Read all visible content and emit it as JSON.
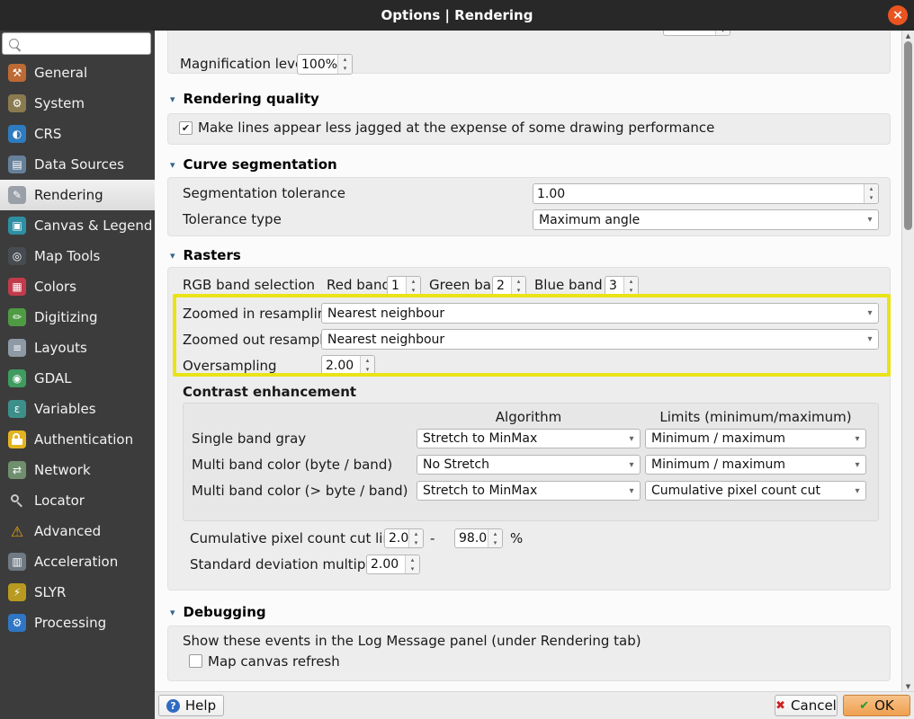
{
  "window": {
    "title": "Options | Rendering"
  },
  "icons": {
    "close": "×",
    "check": "✔",
    "combo_arrow": "▾",
    "spin_up": "▴",
    "spin_down": "▾",
    "section_arrow": "▾",
    "scroll_up": "▲",
    "scroll_down": "▼",
    "help": "?",
    "cancel_x": "✖",
    "ok_check": "✔"
  },
  "colors": {
    "highlight_yellow": "#e9e318",
    "titlebar": "#282828",
    "close_button": "#e95420",
    "ok_button_accent": "#efa050",
    "sidebar_bg": "#3c3c3c"
  },
  "sidebar": {
    "search": {
      "value": ""
    },
    "items": [
      {
        "label": "General",
        "icon": "wrench-icon",
        "glyph": "⚒"
      },
      {
        "label": "System",
        "icon": "gear-icon",
        "glyph": "⚙"
      },
      {
        "label": "CRS",
        "icon": "globe-icon",
        "glyph": "◐"
      },
      {
        "label": "Data Sources",
        "icon": "database-icon",
        "glyph": "▤"
      },
      {
        "label": "Rendering",
        "icon": "paintbrush-icon",
        "glyph": "✎"
      },
      {
        "label": "Canvas & Legend",
        "icon": "canvas-legend-icon",
        "glyph": "▣"
      },
      {
        "label": "Map Tools",
        "icon": "map-tools-icon",
        "glyph": "◎"
      },
      {
        "label": "Colors",
        "icon": "palette-icon",
        "glyph": "▦"
      },
      {
        "label": "Digitizing",
        "icon": "pencil-icon",
        "glyph": "✏"
      },
      {
        "label": "Layouts",
        "icon": "layouts-icon",
        "glyph": "≡"
      },
      {
        "label": "GDAL",
        "icon": "raster-globe-icon",
        "glyph": "◉"
      },
      {
        "label": "Variables",
        "icon": "epsilon-icon",
        "glyph": "ε"
      },
      {
        "label": "Authentication",
        "icon": "lock-icon",
        "glyph": ""
      },
      {
        "label": "Network",
        "icon": "network-icon",
        "glyph": "⇄"
      },
      {
        "label": "Locator",
        "icon": "magnifier-icon",
        "glyph": ""
      },
      {
        "label": "Advanced",
        "icon": "warning-icon",
        "glyph": "⚠"
      },
      {
        "label": "Acceleration",
        "icon": "chip-icon",
        "glyph": "▥"
      },
      {
        "label": "SLYR",
        "icon": "lightning-icon",
        "glyph": "⚡"
      },
      {
        "label": "Processing",
        "icon": "processing-gear-icon",
        "glyph": "⚙"
      }
    ]
  },
  "content": {
    "magnification": {
      "label": "Magnification level",
      "value": "100%"
    },
    "rendering_quality": {
      "header": "Rendering quality",
      "checkbox_label": "Make lines appear less jagged at the expense of some drawing performance",
      "checked": true
    },
    "curve_segmentation": {
      "header": "Curve segmentation",
      "tolerance_label": "Segmentation tolerance",
      "tolerance_value": "1.00",
      "type_label": "Tolerance type",
      "type_value": "Maximum angle"
    },
    "rasters": {
      "header": "Rasters",
      "rgb_label": "RGB band selection",
      "red_band": {
        "label": "Red band",
        "value": "1"
      },
      "green_band": {
        "label": "Green band",
        "value": "2"
      },
      "blue_band": {
        "label": "Blue band",
        "value": "3"
      },
      "zoomed_in": {
        "label": "Zoomed in resampling",
        "value": "Nearest neighbour"
      },
      "zoomed_out": {
        "label": "Zoomed out resampling",
        "value": "Nearest neighbour"
      },
      "oversampling": {
        "label": "Oversampling",
        "value": "2.00"
      },
      "contrast": {
        "title": "Contrast enhancement",
        "col_algorithm": "Algorithm",
        "col_limits": "Limits (minimum/maximum)",
        "rows": [
          {
            "label": "Single band gray",
            "algorithm": "Stretch to MinMax",
            "limits": "Minimum / maximum"
          },
          {
            "label": "Multi band color (byte / band)",
            "algorithm": "No Stretch",
            "limits": "Minimum / maximum"
          },
          {
            "label": "Multi band color (> byte / band)",
            "algorithm": "Stretch to MinMax",
            "limits": "Cumulative pixel count cut"
          }
        ],
        "cumulative": {
          "label": "Cumulative pixel count cut limits",
          "min": "2.0",
          "dash": "-",
          "max": "98.0",
          "unit": "%"
        },
        "stddev": {
          "label": "Standard deviation multiplier",
          "value": "2.00"
        }
      }
    },
    "debugging": {
      "header": "Debugging",
      "note": "Show these events in the Log Message panel (under Rendering tab)",
      "checkbox_label": "Map canvas refresh",
      "checked": false
    }
  },
  "footer": {
    "help": "Help",
    "cancel": "Cancel",
    "ok": "OK"
  }
}
